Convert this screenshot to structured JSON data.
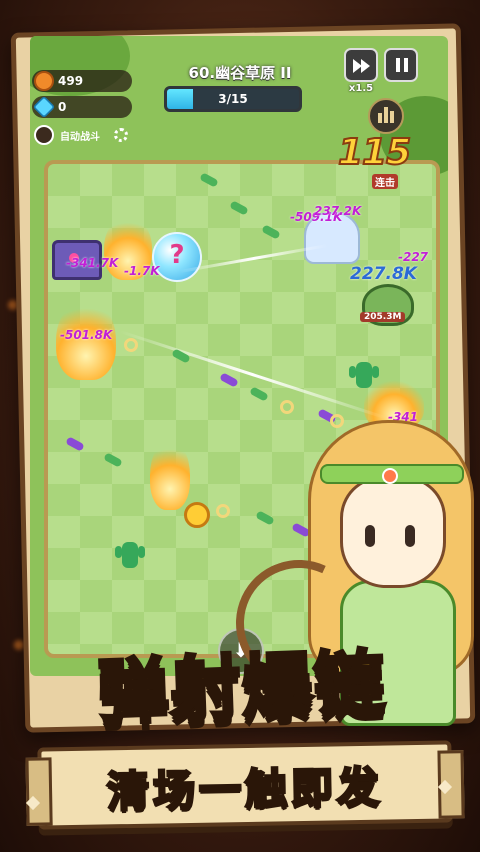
{
  "resources": {
    "gold": "499",
    "gems": "0",
    "gold_color": "#f08a2a",
    "gem_color": "#5ad6ff"
  },
  "auto_battle_label": "自动战斗",
  "stage": {
    "title": "60.幽谷草原 II",
    "progress_text": "3/15",
    "progress": 0.2
  },
  "controls": {
    "speed_label": "x1.5"
  },
  "combo": {
    "count": "115",
    "label": "连击"
  },
  "enemies": {
    "frog_hp": "205.3M"
  },
  "orb_symbol": "?",
  "damage_numbers": [
    {
      "text": "-341.7K",
      "style": "p"
    },
    {
      "text": "-1.7K",
      "style": "p"
    },
    {
      "text": "-501.8K",
      "style": "p"
    },
    {
      "text": "-509.1K",
      "style": "p"
    },
    {
      "text": "227.8K",
      "style": "b"
    },
    {
      "text": "-227",
      "style": "p"
    },
    {
      "text": "-341",
      "style": "p"
    },
    {
      "text": "237.2K",
      "style": "p"
    }
  ],
  "banner": {
    "main": "弹射爆链",
    "sub": "清场一触即发"
  }
}
